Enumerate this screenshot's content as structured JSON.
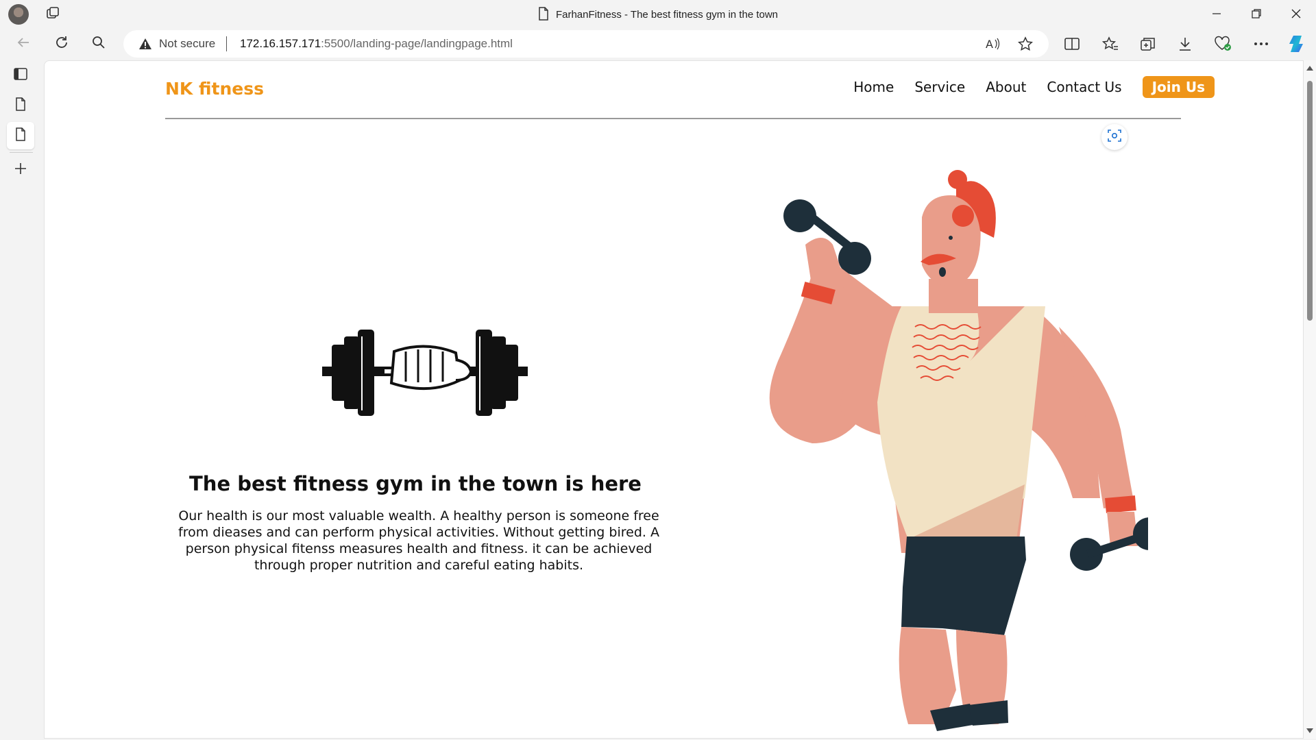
{
  "browser": {
    "tab_title": "FarhanFitness - The best fitness gym in the town",
    "security_label": "Not secure",
    "url_host": "172.16.157.171",
    "url_path": ":5500/landing-page/landingpage.html"
  },
  "site": {
    "brand": "NK fitness",
    "nav": [
      "Home",
      "Service",
      "About",
      "Contact Us"
    ],
    "cta": "Join Us",
    "headline": "The best fitness gym in the town is here",
    "paragraph": "Our health is our most valuable wealth. A healthy person is someone free from dieases and can perform physical activities. Without getting bired. A person physical fitenss measures health and fitness. it can be achieved through proper nutrition and careful eating habits."
  },
  "colors": {
    "accent": "#ef9519",
    "skin": "#e99d8a",
    "shirt": "#f2e2c4",
    "shorts": "#1e2f3a",
    "hair": "#e54c35"
  },
  "icons": [
    "profile-avatar",
    "workspaces-icon",
    "doc-icon",
    "back-icon",
    "refresh-icon",
    "search-icon",
    "warning-icon",
    "read-aloud-icon",
    "favorite-star-icon",
    "split-screen-icon",
    "favorites-icon",
    "collections-icon",
    "download-icon",
    "browser-essentials-icon",
    "more-icon",
    "copilot-icon",
    "visual-search-icon"
  ]
}
